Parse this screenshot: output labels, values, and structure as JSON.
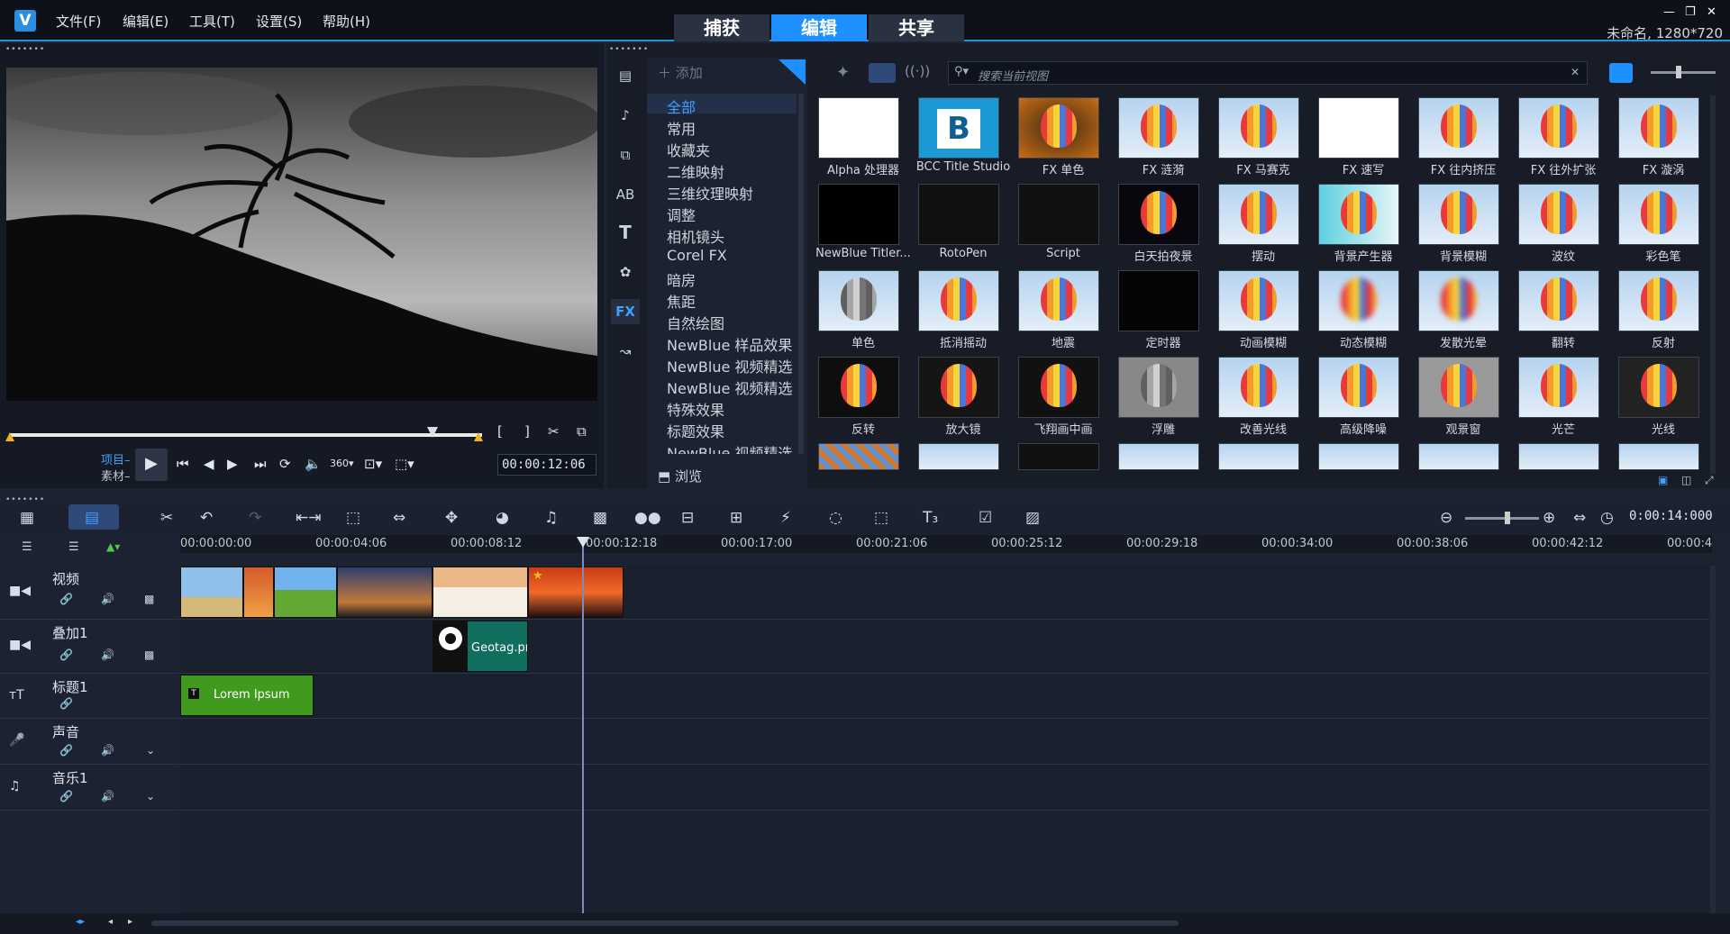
{
  "menu": {
    "file": "文件(F)",
    "edit": "编辑(E)",
    "tools": "工具(T)",
    "settings": "设置(S)",
    "help": "帮助(H)"
  },
  "modes": {
    "capture": "捕获",
    "edit": "编辑",
    "share": "共享"
  },
  "project_info": "未命名, 1280*720",
  "preview": {
    "project_label": "项目–",
    "clip_label": "素材–",
    "timecode": "00:00:12:06"
  },
  "library": {
    "add_label": "添加",
    "search_placeholder": "搜索当前视图",
    "browse_label": "浏览",
    "categories": [
      "全部",
      "常用",
      "收藏夹",
      "二维映射",
      "三维纹理映射",
      "调整",
      "相机镜头",
      "Corel FX",
      "暗房",
      "焦距",
      "自然绘图",
      "NewBlue 样品效果",
      "NewBlue 视频精选",
      "NewBlue 视频精选",
      "特殊效果",
      "标题效果",
      "NewBlue 视频精选"
    ],
    "effects": [
      [
        "Alpha 处理器",
        "BCC Title Studio",
        "FX 单色",
        "FX 涟漪",
        "FX 马赛克",
        "FX 速写",
        "FX 往内挤压",
        "FX 往外扩张",
        "FX 漩涡"
      ],
      [
        "NewBlue Titler...",
        "RotoPen",
        "Script",
        "白天拍夜景",
        "摆动",
        "背景产生器",
        "背景模糊",
        "波纹",
        "彩色笔"
      ],
      [
        "单色",
        "抵消摇动",
        "地震",
        "定时器",
        "动画模糊",
        "动态模糊",
        "发散光晕",
        "翻转",
        "反射"
      ],
      [
        "反转",
        "放大镜",
        "飞翔画中画",
        "浮雕",
        "改善光线",
        "高级降噪",
        "观景窗",
        "光芒",
        "光线"
      ]
    ]
  },
  "timeline": {
    "zoom_timecode": "0:00:14:000",
    "ruler": [
      "00:00:00:00",
      "00:00:04:06",
      "00:00:08:12",
      "00:00:12:18",
      "00:00:17:00",
      "00:00:21:06",
      "00:00:25:12",
      "00:00:29:18",
      "00:00:34:00",
      "00:00:38:06",
      "00:00:42:12",
      "00:00:4"
    ],
    "tracks": [
      "视频",
      "叠加1",
      "标题1",
      "声音",
      "音乐1"
    ],
    "overlay_clip": "Geotag.pn",
    "title_clip": "Lorem Ipsum"
  },
  "colors": {
    "accent": "#1e90ff",
    "title_clip": "#3f9a1e",
    "overlay_clip": "#0f6e5e"
  }
}
